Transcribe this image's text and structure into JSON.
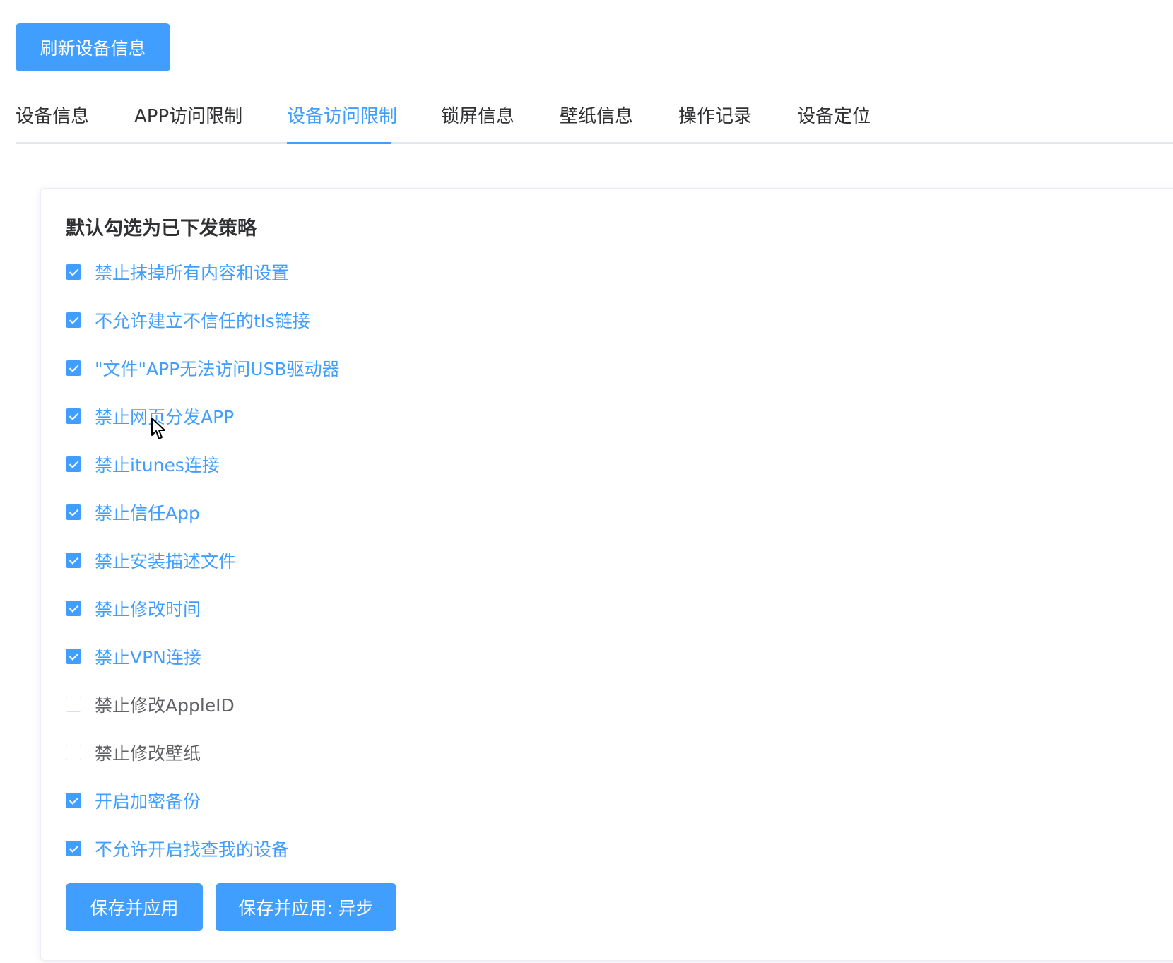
{
  "toolbar": {
    "refresh_label": "刷新设备信息"
  },
  "tabs": [
    {
      "label": "设备信息",
      "active": false
    },
    {
      "label": "APP访问限制",
      "active": false
    },
    {
      "label": "设备访问限制",
      "active": true
    },
    {
      "label": "锁屏信息",
      "active": false
    },
    {
      "label": "壁纸信息",
      "active": false
    },
    {
      "label": "操作记录",
      "active": false
    },
    {
      "label": "设备定位",
      "active": false
    }
  ],
  "card": {
    "title": "默认勾选为已下发策略",
    "options": [
      {
        "label": "禁止抹掉所有内容和设置",
        "checked": true
      },
      {
        "label": "不允许建立不信任的tls链接",
        "checked": true
      },
      {
        "label": "\"文件\"APP无法访问USB驱动器",
        "checked": true
      },
      {
        "label": "禁止网页分发APP",
        "checked": true
      },
      {
        "label": "禁止itunes连接",
        "checked": true
      },
      {
        "label": "禁止信任App",
        "checked": true
      },
      {
        "label": "禁止安装描述文件",
        "checked": true
      },
      {
        "label": "禁止修改时间",
        "checked": true
      },
      {
        "label": "禁止VPN连接",
        "checked": true
      },
      {
        "label": "禁止修改AppleID",
        "checked": false
      },
      {
        "label": "禁止修改壁纸",
        "checked": false
      },
      {
        "label": "开启加密备份",
        "checked": true
      },
      {
        "label": "不允许开启找查我的设备",
        "checked": true
      }
    ],
    "save_label": "保存并应用",
    "save_async_label": "保存并应用: 异步"
  },
  "colors": {
    "accent": "#409eff",
    "text": "#303133",
    "muted_text": "#606266",
    "divider": "#e4e7ed"
  },
  "icons": {
    "cursor": "mouse-pointer-icon",
    "checkbox": "checkmark-icon"
  }
}
